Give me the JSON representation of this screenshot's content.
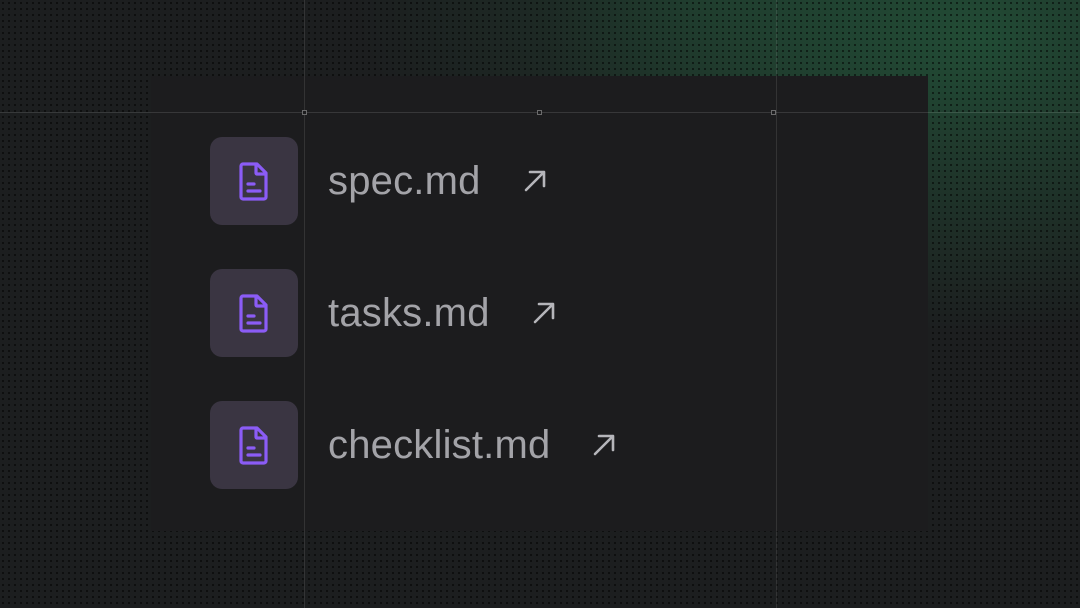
{
  "files": [
    {
      "name": "spec.md",
      "icon": "document-icon",
      "action_icon": "arrow-up-right-icon"
    },
    {
      "name": "tasks.md",
      "icon": "document-icon",
      "action_icon": "arrow-up-right-icon"
    },
    {
      "name": "checklist.md",
      "icon": "document-icon",
      "action_icon": "arrow-up-right-icon"
    }
  ],
  "colors": {
    "icon_accent": "#8b5cf6",
    "icon_tile": "#3a3542",
    "text": "#a3a3a8",
    "panel": "#1c1c1e",
    "background_glow": "#266e46"
  }
}
